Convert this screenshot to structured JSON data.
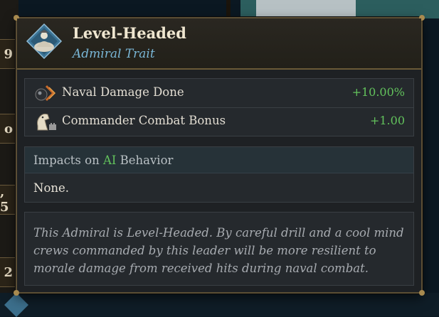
{
  "background": {
    "left_values": [
      "9",
      "o",
      ", 5",
      "2"
    ]
  },
  "tooltip": {
    "title": "Level-Headed",
    "subtitle": "Admiral Trait",
    "modifiers": [
      {
        "icon": "naval-damage-icon",
        "label": "Naval Damage Done",
        "value": "+10.00%"
      },
      {
        "icon": "commander-combat-icon",
        "label": "Commander Combat Bonus",
        "value": "+1.00"
      }
    ],
    "ai_behavior": {
      "heading_prefix": "Impacts on ",
      "heading_ai": "AI",
      "heading_suffix": " Behavior",
      "value": "None."
    },
    "description": "This Admiral is Level-Headed. By careful drill and a cool mind crews commanded by this leader will be more resilient to morale damage from received hits during naval combat."
  },
  "colors": {
    "positive": "#62c25c",
    "subtitle": "#7ab7d7",
    "frame_gold": "#a88a4f"
  }
}
